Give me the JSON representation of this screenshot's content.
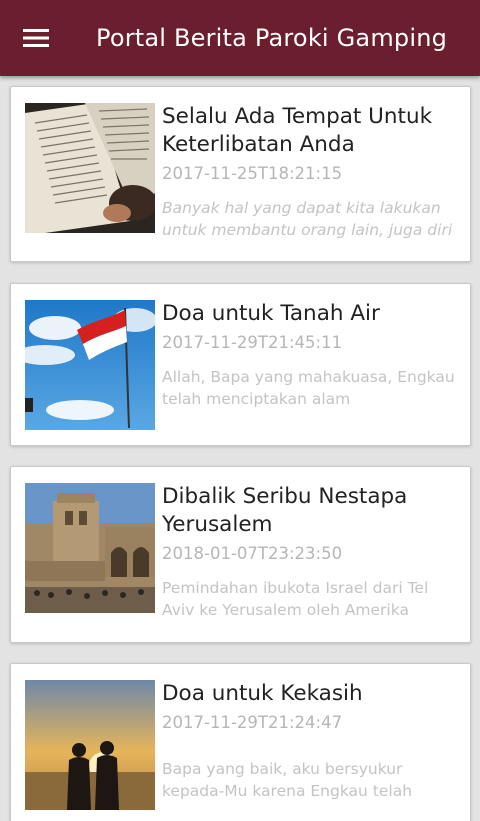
{
  "app": {
    "title": "Portal Berita Paroki Gamping",
    "bar_color": "#6b1f2e",
    "menu_icon": "hamburger-menu-icon"
  },
  "articles": [
    {
      "title": "Selalu Ada Tempat Untuk Keterlibatan Anda",
      "date": "2017-11-25T18:21:15",
      "excerpt": "Banyak hal yang dapat kita lakukan untuk membantu orang lain, juga diri",
      "thumbnail": "open-book-reading-photo"
    },
    {
      "title": "Doa untuk Tanah Air",
      "date": "2017-11-29T21:45:11",
      "excerpt": "Allah, Bapa yang mahakuasa, Engkau telah menciptakan alam",
      "thumbnail": "indonesian-flag-sky-photo"
    },
    {
      "title": "Dibalik Seribu Nestapa Yerusalem",
      "date": "2018-01-07T23:23:50",
      "excerpt": "Pemindahan ibukota Israel dari Tel Aviv ke Yerusalem oleh Amerika",
      "thumbnail": "jerusalem-church-photo"
    },
    {
      "title": "Doa untuk Kekasih",
      "date": "2017-11-29T21:24:47",
      "excerpt": "Bapa yang baik, aku bersyukur kepada-Mu karena Engkau telah",
      "thumbnail": "couple-sunset-beach-photo"
    }
  ]
}
